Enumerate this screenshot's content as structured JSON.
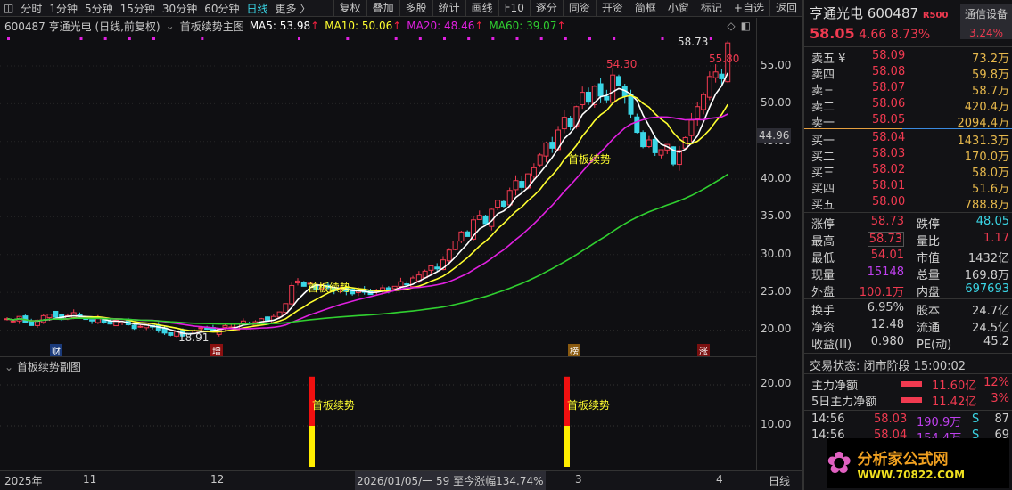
{
  "toolbar": {
    "timeframes": [
      "分时",
      "1分钟",
      "5分钟",
      "15分钟",
      "30分钟",
      "60分钟",
      "日线",
      "更多 〉"
    ],
    "active": "日线",
    "buttons": [
      "复权",
      "叠加",
      "多股",
      "统计",
      "画线",
      "F10",
      "逐分",
      "同资",
      "开资",
      "简框",
      "小窗",
      "标记",
      "+自选",
      "返回"
    ]
  },
  "info": {
    "title": "600487 亨通光电 (日线,前复权)",
    "indicator": "首板续势主图",
    "ma5": "MA5: 53.98",
    "ma10": "MA10: 50.06",
    "ma20": "MA20: 48.46",
    "ma60": "MA60: 39.07",
    "arrow": "↑"
  },
  "colors": {
    "up": "#f03a50",
    "down": "#3ad6e6",
    "ma5": "#ffffff",
    "ma10": "#ffff30",
    "ma20": "#e020e0",
    "ma60": "#30d030"
  },
  "chart_data": {
    "type": "candlestick",
    "title": "600487 亨通光电 日线",
    "closes": [
      21.5,
      21.2,
      21.8,
      21.0,
      20.6,
      21.3,
      21.9,
      22.1,
      21.7,
      21.4,
      21.9,
      22.3,
      21.8,
      21.5,
      21.2,
      21.6,
      21.0,
      20.8,
      21.3,
      21.1,
      20.7,
      20.2,
      20.5,
      20.9,
      20.4,
      20.0,
      19.6,
      19.3,
      19.8,
      19.2,
      19.5,
      19.9,
      20.3,
      20.1,
      19.8,
      20.2,
      20.6,
      20.4,
      20.9,
      21.2,
      20.8,
      21.1,
      21.5,
      21.3,
      21.8,
      22.4,
      23.5,
      25.9,
      26.5,
      25.8,
      26.2,
      25.4,
      25.9,
      25.6,
      25.2,
      25.5,
      25.1,
      24.8,
      25.3,
      25.0,
      24.7,
      25.2,
      25.6,
      25.3,
      25.8,
      26.4,
      26.0,
      26.9,
      27.3,
      27.8,
      28.5,
      28.1,
      29.3,
      30.6,
      31.8,
      33.0,
      32.4,
      34.6,
      35.2,
      34.1,
      36.0,
      37.2,
      36.4,
      38.5,
      39.8,
      38.9,
      40.7,
      41.5,
      43.2,
      44.8,
      44.1,
      46.5,
      48.2,
      47.0,
      49.6,
      51.5,
      50.2,
      52.3,
      51.0,
      50.5,
      53.8,
      52.4,
      51.0,
      48.6,
      46.2,
      44.3,
      45.2,
      43.5,
      43.9,
      44.6,
      42.0,
      43.8,
      45.5,
      47.8,
      49.6,
      51.2,
      53.6,
      54.2,
      53.3,
      58.05
    ],
    "yticks": [
      "55.00",
      "50.00",
      "45.00",
      "40.00",
      "35.00",
      "30.00",
      "25.00",
      "20.00"
    ],
    "ytick_values": [
      55,
      50,
      45,
      40,
      35,
      30,
      25,
      20
    ],
    "current_price_label": "44.96",
    "annotations": {
      "high": "58.73",
      "peak1": "54.30",
      "peak2": "55.80",
      "low": "18.91",
      "signal": "首板续势"
    },
    "markers": [
      "财",
      "增",
      "榜",
      "涨"
    ],
    "sub": {
      "title": "首板续势副图",
      "yticks": [
        "20.00",
        "10.00"
      ],
      "bar_value": 22,
      "bar_split": 10,
      "label": "首板续势"
    },
    "xticks": [
      "2025年",
      "11",
      "12",
      "3",
      "4"
    ],
    "cursor_label": "2026/01/05/一 59 至今涨幅134.74%",
    "period": "日线"
  },
  "panel": {
    "name": "亨通光电",
    "code": "600487",
    "badge": "R500",
    "sector": "通信设备",
    "sector_change": "3.24%",
    "price": "58.05",
    "change": "4.66",
    "pct": "8.73%",
    "asks": [
      [
        "卖五 ¥",
        "58.09",
        "73.2万"
      ],
      [
        "卖四",
        "58.08",
        "59.8万"
      ],
      [
        "卖三",
        "58.07",
        "58.7万"
      ],
      [
        "卖二",
        "58.06",
        "420.4万"
      ],
      [
        "卖一",
        "58.05",
        "2094.4万"
      ]
    ],
    "bids": [
      [
        "买一",
        "58.04",
        "1431.3万"
      ],
      [
        "买二",
        "58.03",
        "170.0万"
      ],
      [
        "买三",
        "58.02",
        "58.0万"
      ],
      [
        "买四",
        "58.01",
        "51.6万"
      ],
      [
        "买五",
        "58.00",
        "788.8万"
      ]
    ],
    "stats": [
      [
        "涨停",
        "58.73",
        "跌停",
        "48.05"
      ],
      [
        "最高",
        "58.73",
        "量比",
        "1.17"
      ],
      [
        "最低",
        "54.01",
        "市值",
        "1432亿"
      ],
      [
        "现量",
        "15148",
        "总量",
        "169.8万"
      ],
      [
        "外盘",
        "100.1万",
        "内盘",
        "697693"
      ]
    ],
    "stats2": [
      [
        "换手",
        "6.95%",
        "股本",
        "24.7亿"
      ],
      [
        "净资",
        "12.48",
        "流通",
        "24.5亿"
      ],
      [
        "收益(Ⅲ)",
        "0.980",
        "PE(动)",
        "45.2"
      ]
    ],
    "status": "交易状态: 闭市阶段 15:00:02",
    "flows": [
      [
        "主力净额",
        "11.60亿",
        "12%"
      ],
      [
        "5日主力净额",
        "11.42亿",
        "3%"
      ]
    ],
    "ticks": [
      [
        "14:56",
        "58.03",
        "190.9万",
        "S",
        "87"
      ],
      [
        "14:56",
        "58.04",
        "154.4万",
        "S",
        "69"
      ]
    ],
    "logo": {
      "title": "分析家公式网",
      "url": "WWW.70822.COM"
    }
  }
}
